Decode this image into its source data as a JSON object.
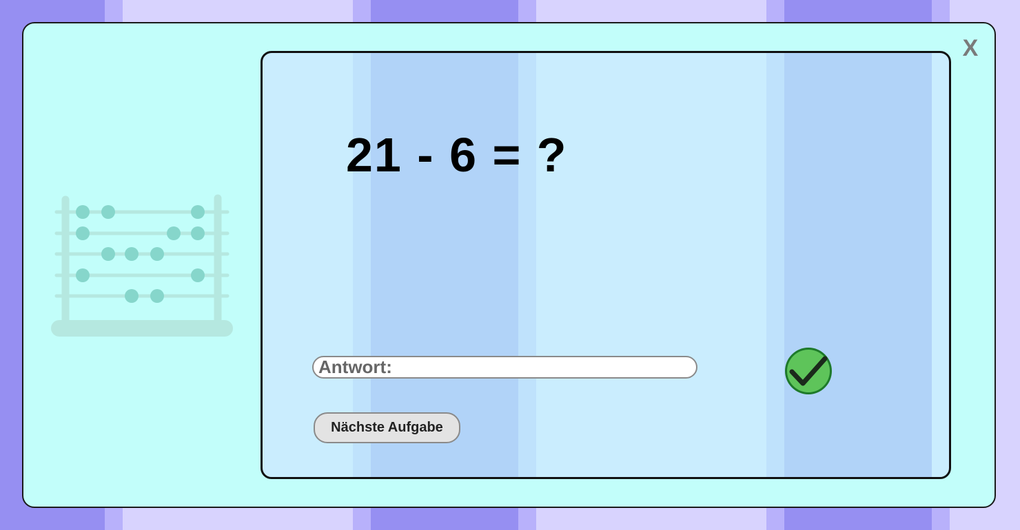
{
  "close": {
    "label": "X"
  },
  "task": {
    "question": "21 - 6 = ?"
  },
  "answer": {
    "placeholder": "Antwort:",
    "value": ""
  },
  "buttons": {
    "next_label": "Nächste Aufgabe"
  },
  "icons": {
    "check": "checkmark-icon",
    "abacus": "abacus-icon"
  },
  "colors": {
    "modal_bg": "#c2fefa",
    "panel_bg": "#caedfe",
    "check_green": "#5ec45a",
    "abacus_color": "#86d6cb"
  }
}
